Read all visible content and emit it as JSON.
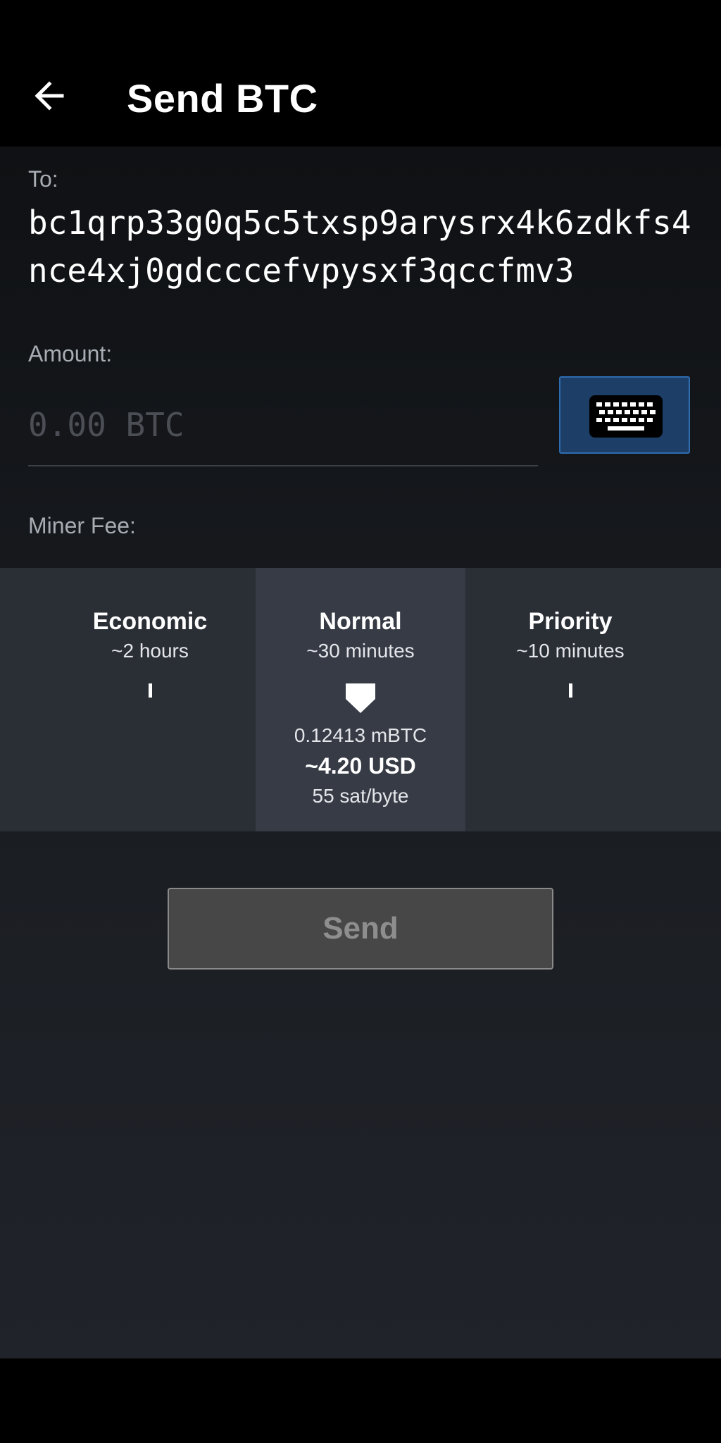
{
  "header": {
    "title": "Send BTC",
    "back_icon": "arrow-left-icon"
  },
  "to": {
    "label": "To:",
    "address": "bc1qrp33g0q5c5txsp9arysrx4k6zdkfs4nce4xj0gdcccefvpysxf3qccfmv3"
  },
  "amount": {
    "label": "Amount:",
    "placeholder": "0.00 BTC",
    "value": "",
    "keyboard_icon": "keyboard-icon"
  },
  "miner_fee": {
    "label": "Miner Fee:",
    "partial_option_fragment": "y",
    "options": [
      {
        "name": "Economic",
        "time": "~2 hours"
      },
      {
        "name": "Normal",
        "time": "~30 minutes",
        "selected": true,
        "btc": "0.12413 mBTC",
        "usd": "~4.20 USD",
        "rate": "55 sat/byte"
      },
      {
        "name": "Priority",
        "time": "~10 minutes"
      }
    ]
  },
  "send_button": {
    "label": "Send",
    "enabled": false
  },
  "colors": {
    "keyboard_button_bg": "#1d3e66",
    "keyboard_button_border": "#2e6cb0",
    "selected_fee_bg": "#363b45",
    "fee_strip_bg": "#2a2e35",
    "send_button_bg": "#474747"
  }
}
